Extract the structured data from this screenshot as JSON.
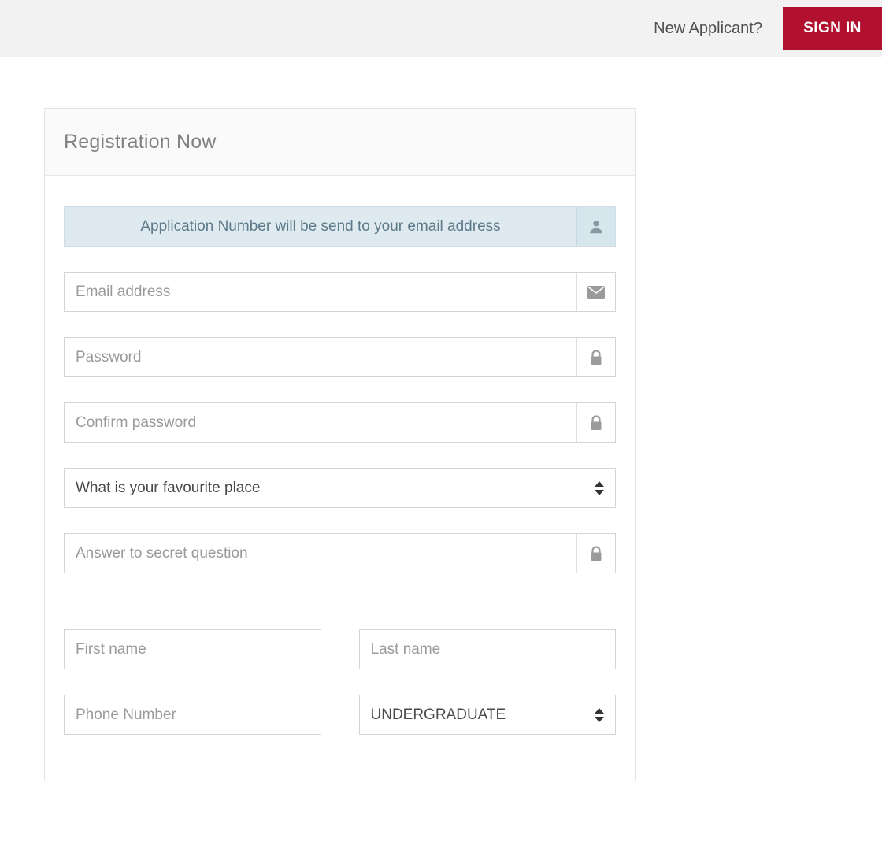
{
  "header": {
    "new_applicant_label": "New Applicant?",
    "sign_in_label": "SIGN IN",
    "sign_in_color": "#b2102f",
    "background_color": "#f2f2f2"
  },
  "card": {
    "title": "Registration Now",
    "notice": {
      "text": "Application Number will be send to your email address",
      "icon": "user-icon",
      "background_color": "#dfeaf0",
      "text_color": "#5c7a89"
    },
    "credentials": [
      {
        "name": "email",
        "placeholder": "Email address",
        "value": "",
        "icon": "envelope-icon",
        "type": "text"
      },
      {
        "name": "password",
        "placeholder": "Password",
        "value": "",
        "icon": "lock-icon",
        "type": "password"
      },
      {
        "name": "confirm-password",
        "placeholder": "Confirm password",
        "value": "",
        "icon": "lock-icon",
        "type": "password"
      }
    ],
    "secret_question": {
      "name": "secret-question",
      "selected": "What is your favourite place",
      "options": [
        "What is your favourite place"
      ]
    },
    "secret_answer": {
      "name": "secret-answer",
      "placeholder": "Answer to secret question",
      "value": "",
      "icon": "lock-icon"
    },
    "personal": {
      "first_name": {
        "placeholder": "First name",
        "value": ""
      },
      "last_name": {
        "placeholder": "Last name",
        "value": ""
      },
      "phone": {
        "placeholder": "Phone Number",
        "value": ""
      },
      "level": {
        "selected": "UNDERGRADUATE",
        "options": [
          "UNDERGRADUATE"
        ]
      }
    }
  }
}
